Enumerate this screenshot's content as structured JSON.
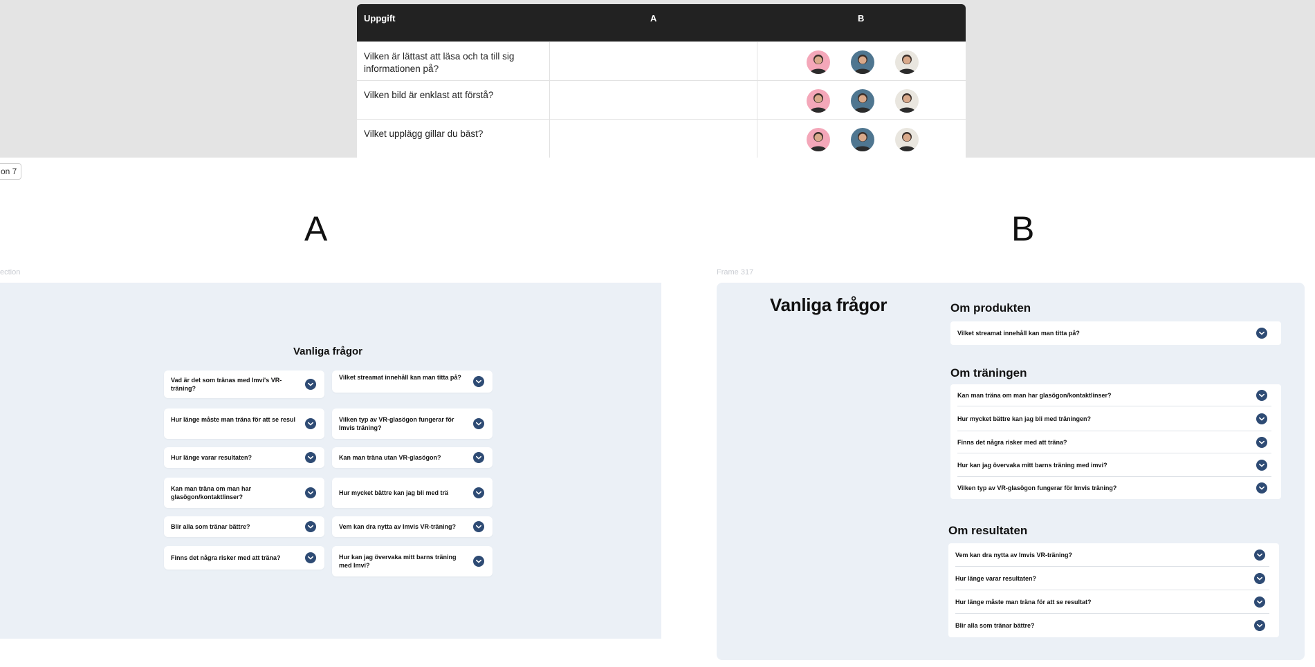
{
  "table": {
    "headers": {
      "task": "Uppgift",
      "a": "A",
      "b": "B"
    },
    "rows": [
      {
        "task": "Vilken är lättast att läsa och ta till sig informationen på?"
      },
      {
        "task": "Vilken bild är enklast att förstå?"
      },
      {
        "task": "Vilket upplägg gillar du bäst?"
      }
    ],
    "avatar_colors": [
      "#f4a7b9",
      "#4f7690",
      "#e9e6df"
    ]
  },
  "section_chip": "on 7",
  "variant_a": {
    "letter": "A",
    "frame_label": "ection",
    "title": "Vanliga frågor",
    "left_column": [
      "Vad är det som tränas med Imvi's VR-träning?",
      "Hur länge måste man träna för att se resul",
      "Hur länge varar resultaten?",
      "Kan man träna om man har glasögon/kontaktlinser?",
      "Blir alla som tränar bättre?",
      "Finns det några risker med att träna?"
    ],
    "right_column": [
      "Vilket streamat innehåll kan man titta på?",
      "Vilken typ av VR-glasögon fungerar för Imvis träning?",
      "Kan man träna utan VR-glasögon?",
      "Hur mycket bättre kan jag bli med trä",
      "Vem kan dra nytta av Imvis VR-träning?",
      "Hur kan jag övervaka mitt barns träning med Imvi?"
    ]
  },
  "variant_b": {
    "letter": "B",
    "frame_label": "Frame 317",
    "title": "Vanliga frågor",
    "groups": [
      {
        "title": "Om produkten",
        "items": [
          "Vilket streamat innehåll kan man titta på?"
        ]
      },
      {
        "title": "Om träningen",
        "items": [
          "Kan man träna om man har glasögon/kontaktlinser?",
          "Hur mycket bättre kan jag bli med träningen?",
          "Finns det några risker med att träna?",
          "Hur kan jag övervaka mitt barns träning med imvi?",
          "Vilken typ av VR-glasögon fungerar för Imvis träning?"
        ]
      },
      {
        "title": "Om resultaten",
        "items": [
          "Vem kan dra nytta av Imvis VR-träning?",
          "Hur länge varar resultaten?",
          "Hur länge måste man träna för att se resultat?",
          "Blir alla som tränar bättre?"
        ]
      }
    ]
  },
  "colors": {
    "chevron": "#2e4b74",
    "frame_bg": "#ebf0f6",
    "table_header": "#222222"
  },
  "icons": {
    "chevron": "chevron-down-icon",
    "avatar": "person-avatar-icon"
  }
}
